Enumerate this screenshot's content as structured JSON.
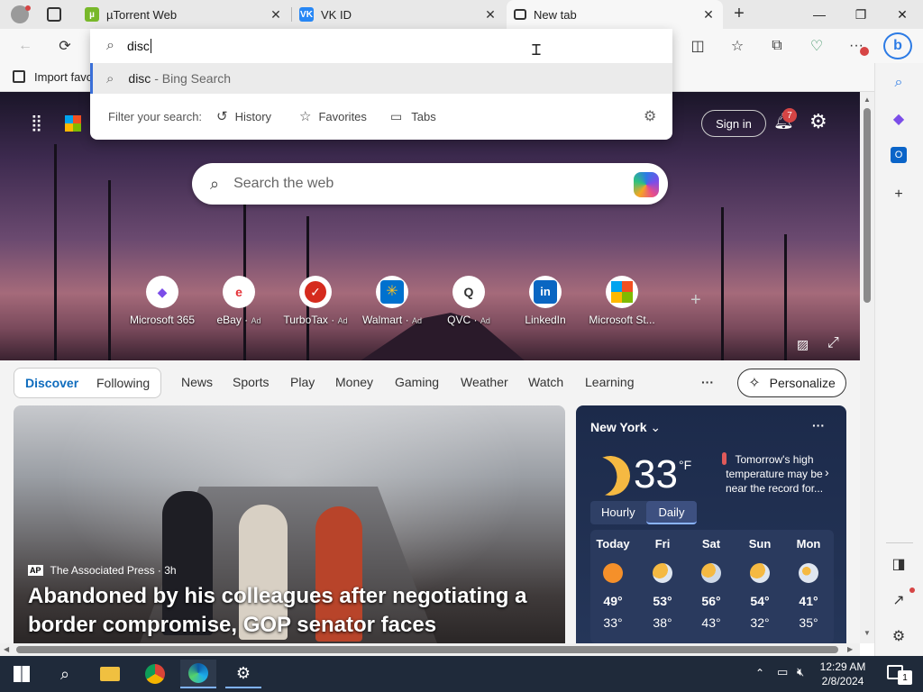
{
  "tabs": [
    {
      "title": "µTorrent Web",
      "icon": "utorrent-icon"
    },
    {
      "title": "VK ID",
      "icon": "vk-icon"
    },
    {
      "title": "New tab",
      "icon": "newtab-icon",
      "active": true
    }
  ],
  "window": {
    "minimize": "—",
    "restore": "❐",
    "close": "✕"
  },
  "omnibox": {
    "query": "disc",
    "suggestion_term": "disc",
    "suggestion_suffix": " - Bing Search",
    "filter_label": "Filter your search:",
    "filters": [
      "History",
      "Favorites",
      "Tabs"
    ]
  },
  "favbar": {
    "import_label": "Import favo"
  },
  "hero": {
    "search_placeholder": "Search the web",
    "signin_label": "Sign in",
    "notification_count": "7"
  },
  "quick_links": [
    {
      "label": "Microsoft 365",
      "ad": ""
    },
    {
      "label": "eBay",
      "ad": "Ad"
    },
    {
      "label": "TurboTax",
      "ad": "Ad"
    },
    {
      "label": "Walmart",
      "ad": "Ad"
    },
    {
      "label": "QVC",
      "ad": "Ad"
    },
    {
      "label": "LinkedIn",
      "ad": ""
    },
    {
      "label": "Microsoft St...",
      "ad": ""
    }
  ],
  "feed": {
    "pills": [
      "Discover",
      "Following"
    ],
    "nav": [
      "News",
      "Sports",
      "Play",
      "Money",
      "Gaming",
      "Weather",
      "Watch",
      "Learning"
    ],
    "more": "···",
    "personalize_label": "Personalize"
  },
  "news": {
    "source": "The Associated Press · 3h",
    "source_logo": "AP",
    "headline": "Abandoned by his colleagues after negotiating a border compromise, GOP senator faces backlash..."
  },
  "weather": {
    "location": "New York",
    "temp": "33",
    "unit": "°F",
    "alert": "Tomorrow's high temperature may be near the record for...",
    "toggle": [
      "Hourly",
      "Daily"
    ],
    "days": [
      {
        "name": "Today",
        "hi": "49°",
        "lo": "33°",
        "icon": "sun"
      },
      {
        "name": "Fri",
        "hi": "53°",
        "lo": "38°",
        "icon": "partly-cloudy"
      },
      {
        "name": "Sat",
        "hi": "56°",
        "lo": "43°",
        "icon": "partly-cloudy"
      },
      {
        "name": "Sun",
        "hi": "54°",
        "lo": "32°",
        "icon": "partly-cloudy"
      },
      {
        "name": "Mon",
        "hi": "41°",
        "lo": "35°",
        "icon": "cloudy"
      }
    ]
  },
  "taskbar": {
    "time": "12:29 AM",
    "date": "2/8/2024",
    "notifications": "1"
  }
}
